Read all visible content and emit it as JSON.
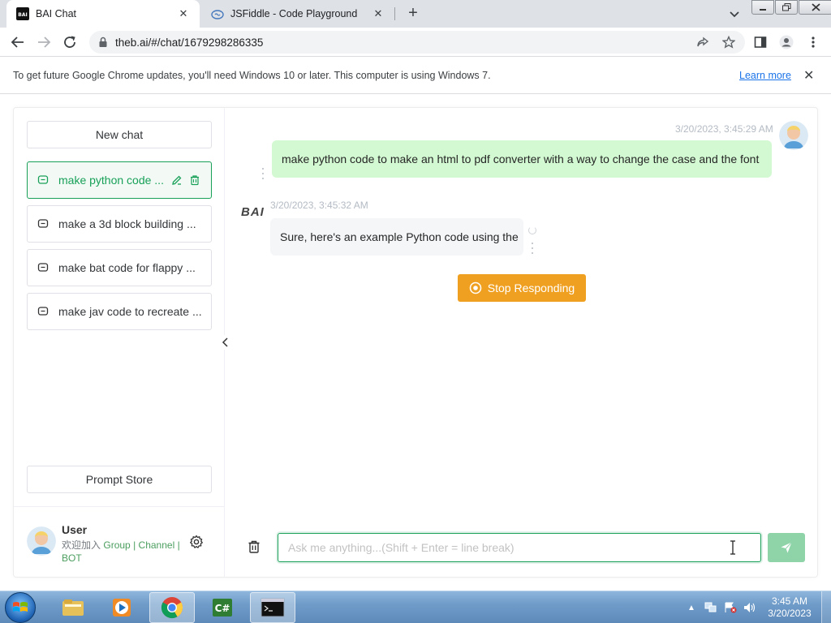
{
  "browser": {
    "tabs": [
      {
        "title": "BAI Chat",
        "active": true
      },
      {
        "title": "JSFiddle - Code Playground",
        "active": false
      }
    ],
    "new_tab_label": "+",
    "url": "theb.ai/#/chat/1679298286335",
    "infobar": {
      "message": "To get future Google Chrome updates, you'll need Windows 10 or later. This computer is using Windows 7.",
      "link": "Learn more"
    }
  },
  "sidebar": {
    "new_chat_label": "New chat",
    "chats": [
      {
        "label": "make python code ...",
        "active": true
      },
      {
        "label": "make a 3d block building ...",
        "active": false
      },
      {
        "label": "make bat code for flappy ...",
        "active": false
      },
      {
        "label": "make jav code to recreate ...",
        "active": false
      }
    ],
    "prompt_store_label": "Prompt Store",
    "user": {
      "name": "User",
      "join_prefix": "欢迎加入",
      "group": "Group",
      "sep1": "|",
      "channel": "Channel",
      "sep2": "|",
      "bot": "BOT"
    }
  },
  "chat": {
    "user_message": {
      "time": "3/20/2023, 3:45:29 AM",
      "text": "make python code to make an html to pdf converter with a way to change the case and the font"
    },
    "bot_message": {
      "logo": "BAI",
      "time": "3/20/2023, 3:45:32 AM",
      "text": "Sure, here's an example Python code using the"
    },
    "stop_label": "Stop Responding",
    "input_placeholder": "Ask me anything...(Shift + Enter = line break)"
  },
  "taskbar": {
    "time": "3:45 AM",
    "date": "3/20/2023"
  },
  "colors": {
    "accent": "#18a058",
    "user_bubble": "#d2f9d1",
    "stop_button": "#f0a020",
    "send_button": "#8fd3a9"
  }
}
